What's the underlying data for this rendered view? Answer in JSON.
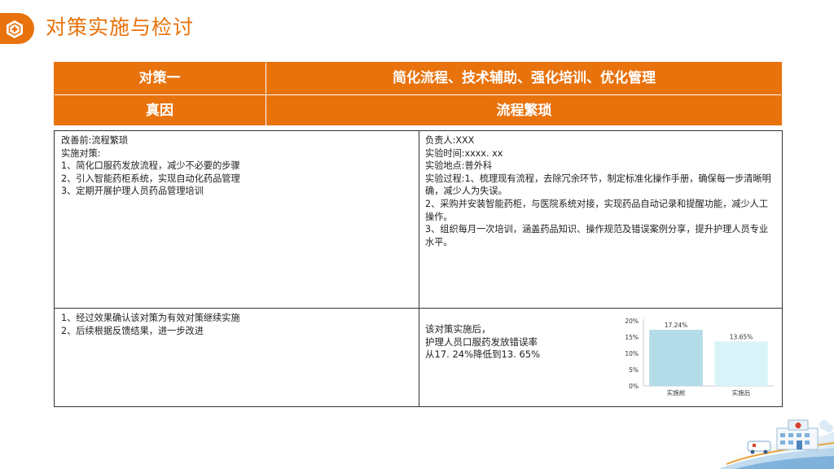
{
  "page": {
    "title": "对策实施与检讨",
    "icon": "hexagon-medical-icon",
    "accent_color": "#e8720c"
  },
  "header_table": {
    "row1": {
      "label": "对策一",
      "value": "简化流程、技术辅助、强化培训、优化管理"
    },
    "row2": {
      "label": "真因",
      "value": "流程繁琐"
    }
  },
  "content": {
    "before": {
      "lines": [
        "改善前:流程繁琐",
        "实施对策:",
        "1、简化口服药发放流程，减少不必要的步骤",
        "2、引入智能药柜系统，实现自动化药品管理",
        "3、定期开展护理人员药品管理培训"
      ]
    },
    "implementation": {
      "lines": [
        "负责人:XXX",
        "实验时间:xxxx. xx",
        "实验地点:普外科",
        "实验过程:1、梳理现有流程，去除冗余环节，制定标准化操作手册，确保每一步清晰明确，减少人为失误。",
        "2、采购并安装智能药柜，与医院系统对接，实现药品自动记录和提醒功能，减少人工操作。",
        "3、组织每月一次培训，涵盖药品知识、操作规范及错误案例分享，提升护理人员专业水平。"
      ]
    },
    "follow_up": {
      "lines": [
        "1、经过效果确认该对策为有效对策继续实施",
        "2、后续根据反馈结果，进一步改进"
      ]
    },
    "result": {
      "lines": [
        "该对策实施后，",
        "护理人员口服药发放错误率",
        "从17. 24%降低到13. 65%"
      ]
    }
  },
  "chart_data": {
    "type": "bar",
    "categories": [
      "实施前",
      "实施后"
    ],
    "values": [
      17.24,
      13.65
    ],
    "data_labels": [
      "17.24%",
      "13.65%"
    ],
    "y_ticks": [
      "0%",
      "5%",
      "10%",
      "15%",
      "20%"
    ],
    "ylim": [
      0,
      20
    ],
    "bar_colors": [
      "#b3dbe8",
      "#d9f4f9"
    ],
    "title": "",
    "xlabel": "",
    "ylabel": ""
  }
}
